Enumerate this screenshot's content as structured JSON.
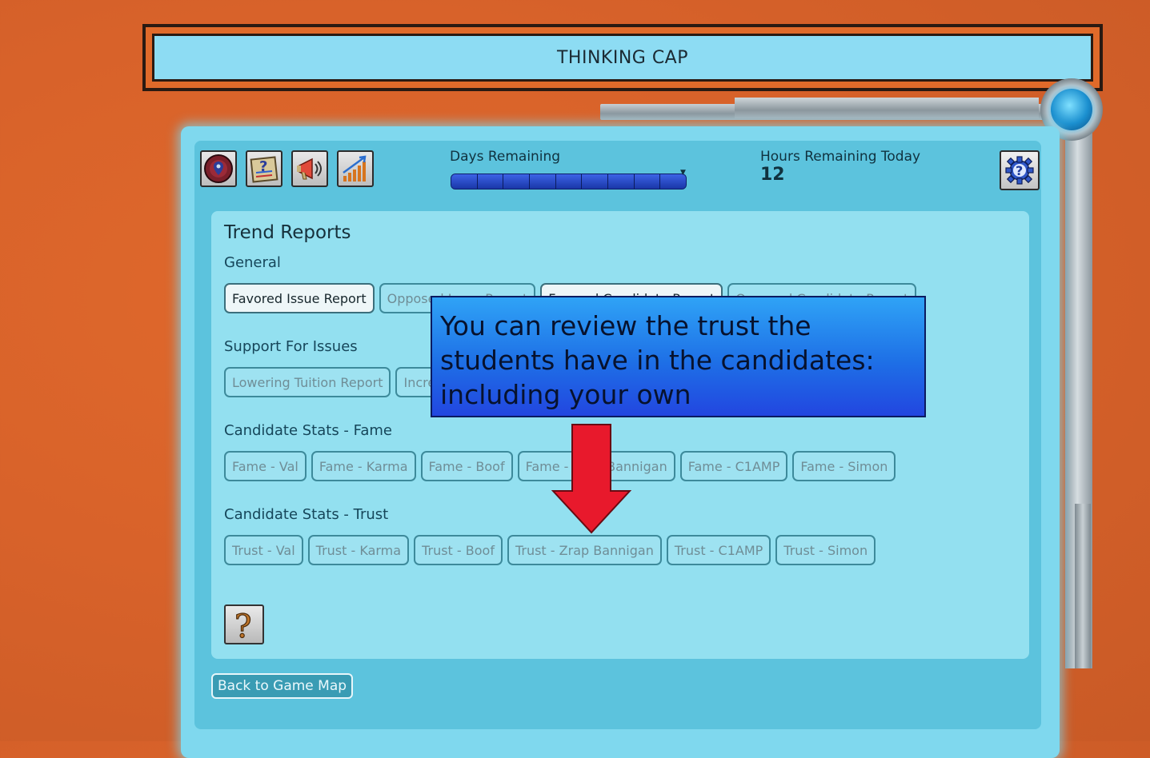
{
  "title": "THINKING CAP",
  "toolbar": {
    "icons": [
      "map-pin-icon",
      "clipboard-question-icon",
      "megaphone-icon",
      "bar-chart-icon"
    ],
    "days_label": "Days Remaining",
    "days_total_segments": 9,
    "days_remaining_segments": 9,
    "hours_label": "Hours Remaining Today",
    "hours_value": "12",
    "settings_icon": "gear-question-icon"
  },
  "page": {
    "heading": "Trend Reports",
    "sections": [
      {
        "title": "General",
        "buttons": [
          "Favored Issue Report",
          "Opposed Issue Report",
          "Favored Candidate Report",
          "Opposed Candidate Report"
        ]
      },
      {
        "title": "Support For Issues",
        "buttons": [
          "Lowering Tuition Report",
          "Increasing Report"
        ]
      },
      {
        "title": "Candidate Stats - Fame",
        "buttons": [
          "Fame - Val",
          "Fame - Karma",
          "Fame - Boof",
          "Fame - Zrap Bannigan",
          "Fame - C1AMP",
          "Fame - Simon"
        ]
      },
      {
        "title": "Candidate Stats - Trust",
        "buttons": [
          "Trust - Val",
          "Trust - Karma",
          "Trust - Boof",
          "Trust - Zrap Bannigan",
          "Trust - C1AMP",
          "Trust - Simon"
        ]
      }
    ],
    "help_icon": "question-mark-icon",
    "back_label": "Back to Game Map"
  },
  "tutorial": {
    "message": "You can review the trust the students have in the candidates: including your own",
    "arrow_color": "#e8192c"
  },
  "colors": {
    "background": "#d8622a",
    "panel": "#7fd8ee",
    "tip": "#2a7cf0"
  }
}
